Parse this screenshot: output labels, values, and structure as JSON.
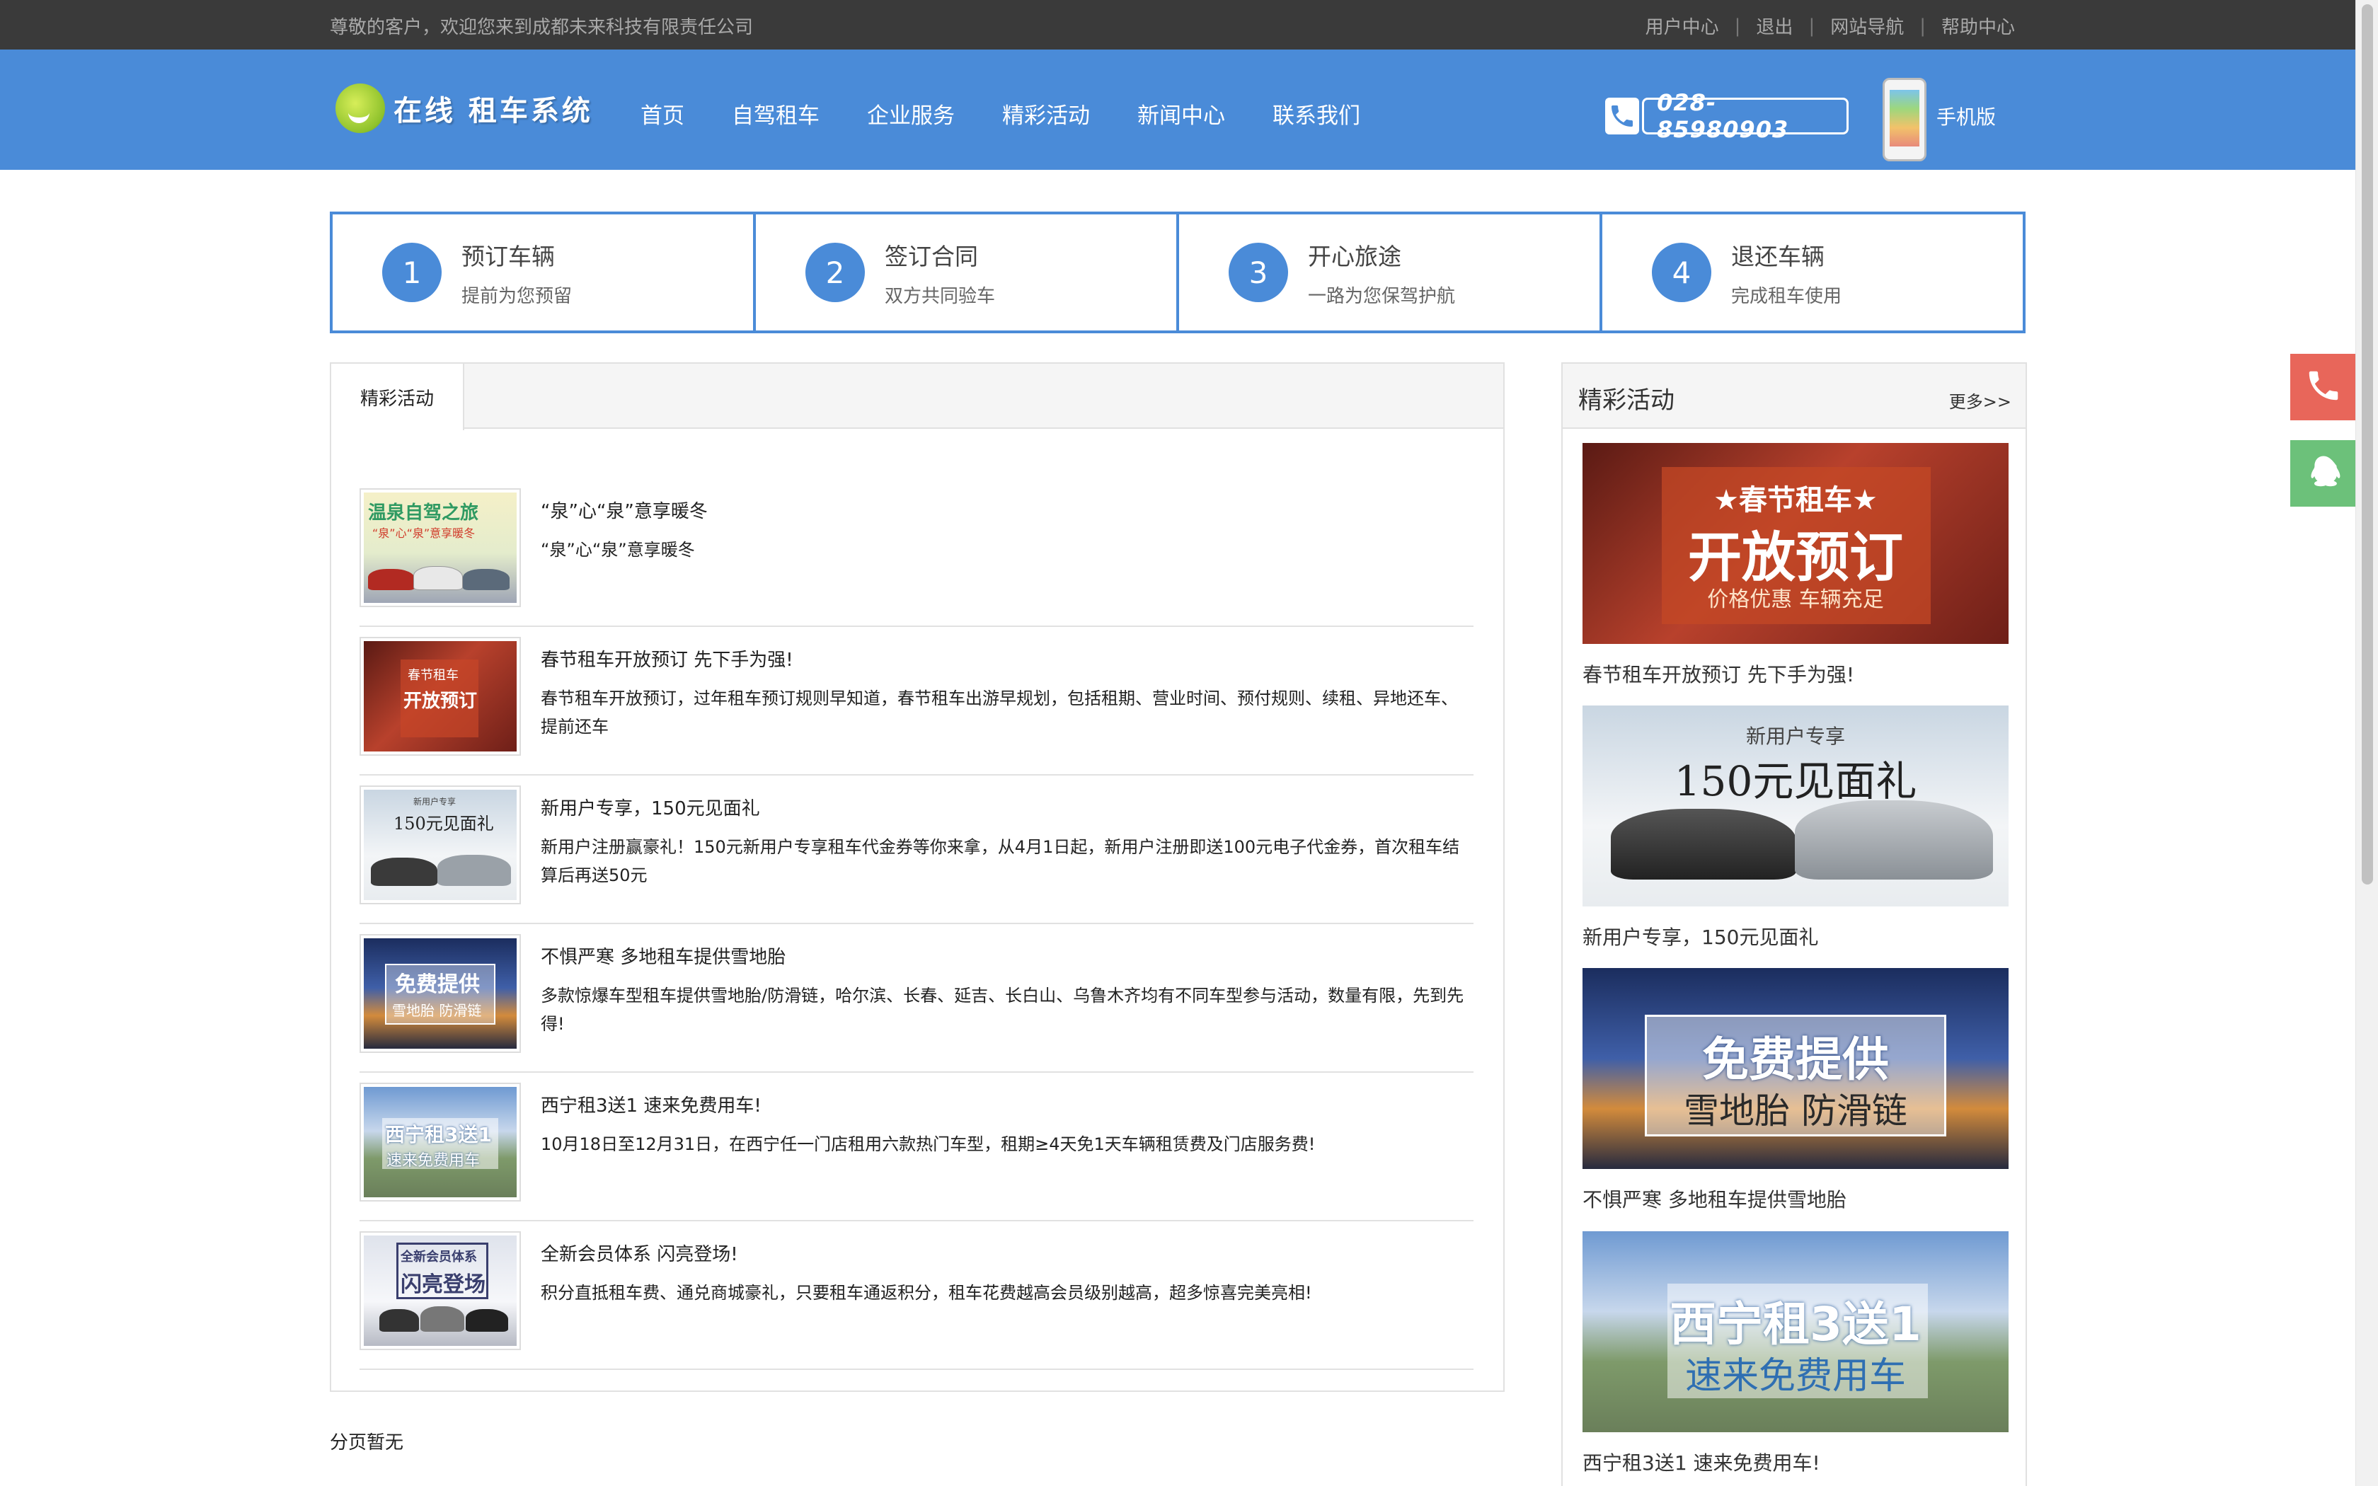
{
  "topbar": {
    "welcome": "尊敬的客户，欢迎您来到成都未来科技有限责任公司",
    "links": [
      "用户中心",
      "退出",
      "网站导航",
      "帮助中心"
    ]
  },
  "header": {
    "logo_text": "在线 租车系统",
    "nav": [
      "首页",
      "自驾租车",
      "企业服务",
      "精彩活动",
      "新闻中心",
      "联系我们"
    ],
    "phone": "028-85980903",
    "mobile_label": "手机版"
  },
  "steps": [
    {
      "num": "1",
      "title": "预订车辆",
      "sub": "提前为您预留"
    },
    {
      "num": "2",
      "title": "签订合同",
      "sub": "双方共同验车"
    },
    {
      "num": "3",
      "title": "开心旅途",
      "sub": "一路为您保驾护航"
    },
    {
      "num": "4",
      "title": "退还车辆",
      "sub": "完成租车使用"
    }
  ],
  "main": {
    "tab": "精彩活动",
    "items": [
      {
        "title": "“泉”心“泉”意享暖冬",
        "desc": "“泉”心“泉”意享暖冬",
        "thumb_text_1": "温泉自驾之旅",
        "thumb_text_2": "“泉”心“泉”意享暖冬"
      },
      {
        "title": "春节租车开放预订 先下手为强!",
        "desc": "春节租车开放预订，过年租车预订规则早知道，春节租车出游早规划，包括租期、营业时间、预付规则、续租、异地还车、提前还车",
        "thumb_text_1": "春节租车",
        "thumb_text_2": "开放预订"
      },
      {
        "title": "新用户专享，150元见面礼",
        "desc": "新用户注册赢豪礼！150元新用户专享租车代金券等你来拿，从4月1日起，新用户注册即送100元电子代金券，首次租车结算后再送50元",
        "thumb_text_1": "新用户专享",
        "thumb_text_2": "150元见面礼"
      },
      {
        "title": "不惧严寒 多地租车提供雪地胎",
        "desc": "多款惊爆车型租车提供雪地胎/防滑链，哈尔滨、长春、延吉、长白山、乌鲁木齐均有不同车型参与活动，数量有限，先到先得!",
        "thumb_text_1": "免费提供",
        "thumb_text_2": "雪地胎 防滑链"
      },
      {
        "title": "西宁租3送1 速来免费用车!",
        "desc": "10月18日至12月31日，在西宁任一门店租用六款热门车型，租期≥4天免1天车辆租赁费及门店服务费!",
        "thumb_text_1": "西宁租3送1",
        "thumb_text_2": "速来免费用车"
      },
      {
        "title": "全新会员体系 闪亮登场!",
        "desc": "积分直抵租车费、通兑商城豪礼，只要租车通返积分，租车花费越高会员级别越高，超多惊喜完美亮相!",
        "thumb_text_1": "全新会员体系",
        "thumb_text_2": "闪亮登场"
      }
    ]
  },
  "pagination": "分页暂无",
  "sidebar": {
    "title": "精彩活动",
    "more": "更多>>",
    "promos": [
      {
        "caption": "春节租车开放预订 先下手为强!",
        "line_1": "★春节租车★",
        "line_2": "开放预订",
        "line_3": "价格优惠 车辆充足"
      },
      {
        "caption": "新用户专享，150元见面礼",
        "line_1": "新用户专享",
        "line_2": "150元见面礼"
      },
      {
        "caption": "不惧严寒 多地租车提供雪地胎",
        "line_1": "免费提供",
        "line_2": "雪地胎 防滑链"
      },
      {
        "caption": "西宁租3送1 速来免费用车!",
        "line_1": "西宁租3送1",
        "line_2": "速来免费用车"
      }
    ]
  },
  "colors": {
    "brand_blue": "#4a8bd8",
    "topbar_bg": "#3a3a3a",
    "float_phone": "#e8665a",
    "float_qq": "#6cc17a"
  },
  "icons": [
    "phone-icon",
    "mobile-phone-icon",
    "qq-icon",
    "logo-icon"
  ]
}
